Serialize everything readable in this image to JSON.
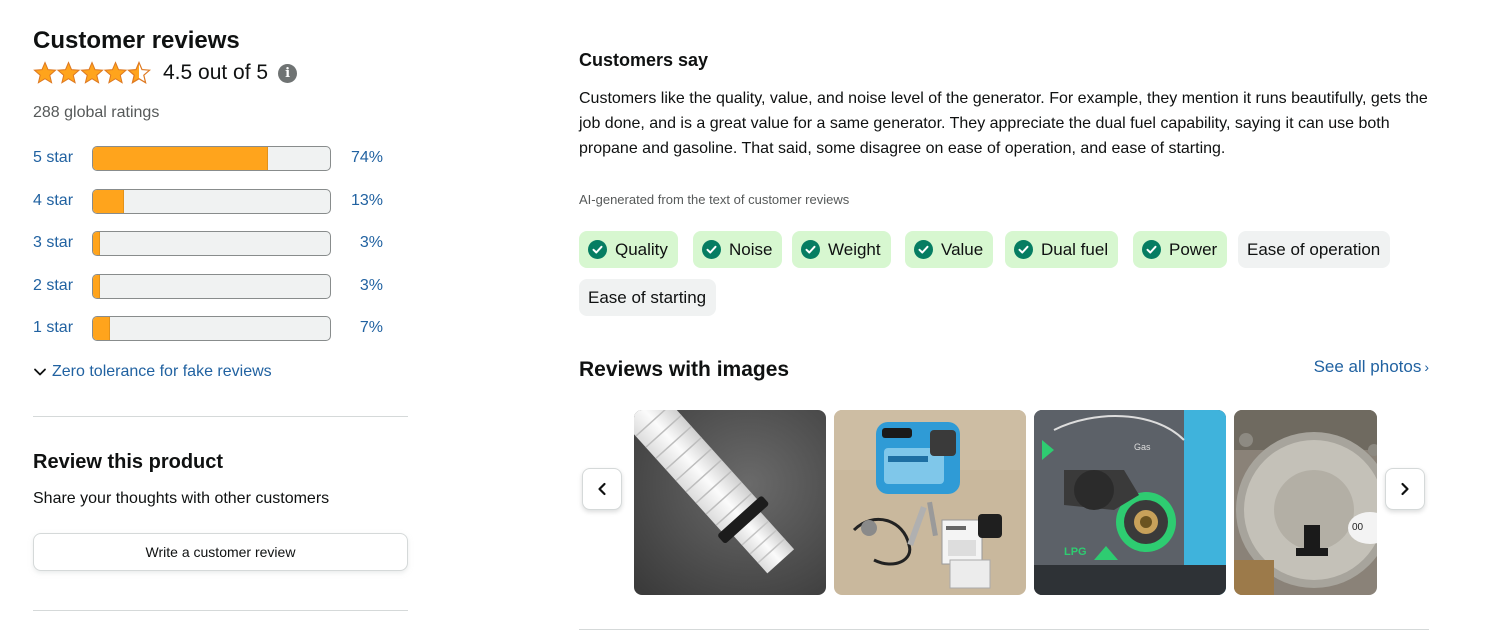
{
  "customer_reviews": {
    "title": "Customer reviews",
    "rating_text": "4.5 out of 5",
    "rating_value": 4.5,
    "global_ratings": "288 global ratings",
    "histogram": [
      {
        "label": "5 star",
        "pct_text": "74%",
        "pct": 74
      },
      {
        "label": "4 star",
        "pct_text": "13%",
        "pct": 13
      },
      {
        "label": "3 star",
        "pct_text": "3%",
        "pct": 3
      },
      {
        "label": "2 star",
        "pct_text": "3%",
        "pct": 3
      },
      {
        "label": "1 star",
        "pct_text": "7%",
        "pct": 7
      }
    ],
    "zero_tolerance_link": "Zero tolerance for fake reviews"
  },
  "review_product": {
    "title": "Review this product",
    "subtitle": "Share your thoughts with other customers",
    "button_label": "Write a customer review"
  },
  "customers_say": {
    "title": "Customers say",
    "summary": "Customers like the quality, value, and noise level of the generator. For example, they mention it runs beautifully, gets the job done, and is a great value for a same generator. They appreciate the dual fuel capability, saying it can use both propane and gasoline. That said, some disagree on ease of operation, and ease of starting.",
    "ai_note": "AI-generated from the text of customer reviews",
    "aspects": [
      {
        "label": "Quality",
        "sentiment": "positive"
      },
      {
        "label": "Noise",
        "sentiment": "positive"
      },
      {
        "label": "Weight",
        "sentiment": "positive"
      },
      {
        "label": "Value",
        "sentiment": "positive"
      },
      {
        "label": "Dual fuel",
        "sentiment": "positive"
      },
      {
        "label": "Power",
        "sentiment": "positive"
      },
      {
        "label": "Ease of operation",
        "sentiment": "mixed"
      },
      {
        "label": "Ease of starting",
        "sentiment": "mixed"
      }
    ]
  },
  "reviews_with_images": {
    "title": "Reviews with images",
    "see_all": "See all photos",
    "see_all_icon": "chevron-right-icon",
    "prev_icon": "chevron-left-icon",
    "next_icon": "chevron-right-icon"
  },
  "colors": {
    "star": "#ffa41c",
    "link": "#2162a1",
    "positive_chip": "#d7f7d0",
    "neutral_chip": "#f0f2f2",
    "check": "#067d62"
  }
}
